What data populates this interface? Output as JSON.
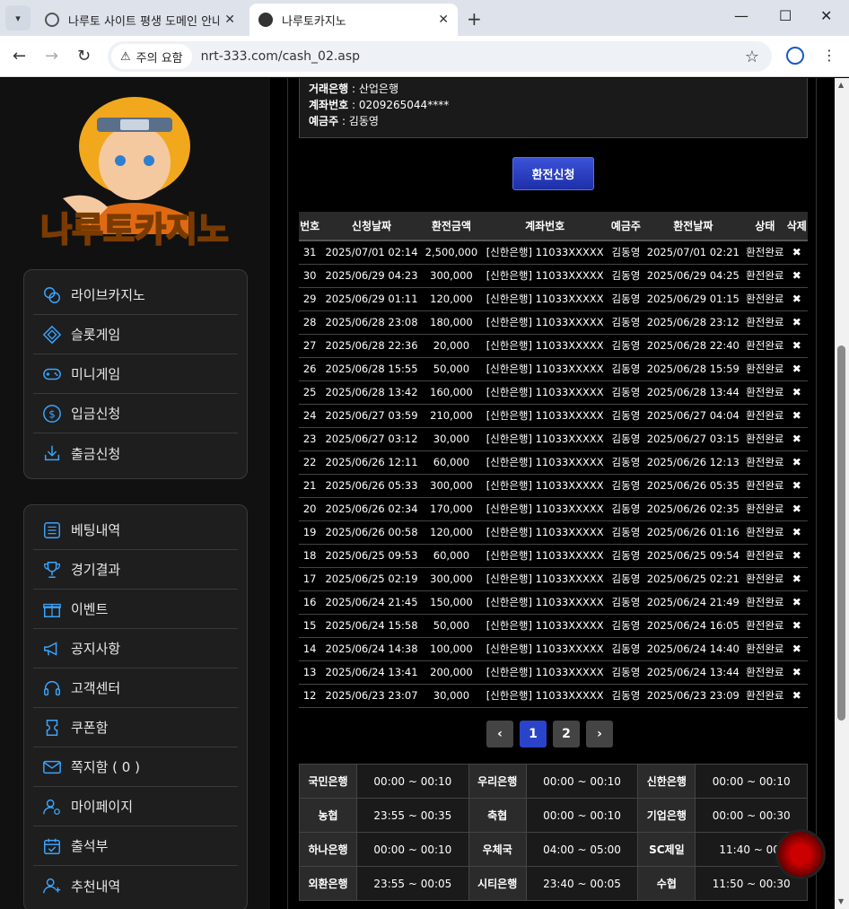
{
  "browser": {
    "tabs": [
      {
        "title": "나루토 사이트 평생 도메인 안내"
      },
      {
        "title": "나루토카지노"
      }
    ],
    "security_label": "주의 요함",
    "url": "nrt-333.com/cash_02.asp"
  },
  "sidebar": {
    "logo_text": "나루토카지노",
    "menu1": [
      {
        "label": "라이브카지노",
        "icon": "casino-chip-icon"
      },
      {
        "label": "슬롯게임",
        "icon": "diamond-icon"
      },
      {
        "label": "미니게임",
        "icon": "gamepad-icon"
      },
      {
        "label": "입금신청",
        "icon": "dollar-coin-icon"
      },
      {
        "label": "출금신청",
        "icon": "download-icon"
      }
    ],
    "menu2": [
      {
        "label": "베팅내역",
        "icon": "list-icon"
      },
      {
        "label": "경기결과",
        "icon": "trophy-icon"
      },
      {
        "label": "이벤트",
        "icon": "gift-icon"
      },
      {
        "label": "공지사항",
        "icon": "megaphone-icon"
      },
      {
        "label": "고객센터",
        "icon": "headset-icon"
      },
      {
        "label": "쿠폰함",
        "icon": "coupon-icon"
      },
      {
        "label": "쪽지함 ( 0 )",
        "icon": "envelope-icon"
      },
      {
        "label": "마이페이지",
        "icon": "user-gear-icon"
      },
      {
        "label": "출석부",
        "icon": "calendar-check-icon"
      },
      {
        "label": "추천내역",
        "icon": "user-plus-icon"
      }
    ]
  },
  "account": {
    "bank_label": "거래은행",
    "bank_value": "산업은행",
    "account_label": "계좌번호",
    "account_value": "0209265044****",
    "holder_label": "예금주",
    "holder_value": "김동영"
  },
  "withdraw_button": "환전신청",
  "table": {
    "headers": [
      "번호",
      "신청날짜",
      "환전금액",
      "계좌번호",
      "예금주",
      "환전날짜",
      "상태",
      "삭제"
    ],
    "rows": [
      [
        "31",
        "2025/07/01 02:14",
        "2,500,000",
        "[신한은행] 11033XXXXX",
        "김동영",
        "2025/07/01 02:21",
        "환전완료"
      ],
      [
        "30",
        "2025/06/29 04:23",
        "300,000",
        "[신한은행] 11033XXXXX",
        "김동영",
        "2025/06/29 04:25",
        "환전완료"
      ],
      [
        "29",
        "2025/06/29 01:11",
        "120,000",
        "[신한은행] 11033XXXXX",
        "김동영",
        "2025/06/29 01:15",
        "환전완료"
      ],
      [
        "28",
        "2025/06/28 23:08",
        "180,000",
        "[신한은행] 11033XXXXX",
        "김동영",
        "2025/06/28 23:12",
        "환전완료"
      ],
      [
        "27",
        "2025/06/28 22:36",
        "20,000",
        "[신한은행] 11033XXXXX",
        "김동영",
        "2025/06/28 22:40",
        "환전완료"
      ],
      [
        "26",
        "2025/06/28 15:55",
        "50,000",
        "[신한은행] 11033XXXXX",
        "김동영",
        "2025/06/28 15:59",
        "환전완료"
      ],
      [
        "25",
        "2025/06/28 13:42",
        "160,000",
        "[신한은행] 11033XXXXX",
        "김동영",
        "2025/06/28 13:44",
        "환전완료"
      ],
      [
        "24",
        "2025/06/27 03:59",
        "210,000",
        "[신한은행] 11033XXXXX",
        "김동영",
        "2025/06/27 04:04",
        "환전완료"
      ],
      [
        "23",
        "2025/06/27 03:12",
        "30,000",
        "[신한은행] 11033XXXXX",
        "김동영",
        "2025/06/27 03:15",
        "환전완료"
      ],
      [
        "22",
        "2025/06/26 12:11",
        "60,000",
        "[신한은행] 11033XXXXX",
        "김동영",
        "2025/06/26 12:13",
        "환전완료"
      ],
      [
        "21",
        "2025/06/26 05:33",
        "300,000",
        "[신한은행] 11033XXXXX",
        "김동영",
        "2025/06/26 05:35",
        "환전완료"
      ],
      [
        "20",
        "2025/06/26 02:34",
        "170,000",
        "[신한은행] 11033XXXXX",
        "김동영",
        "2025/06/26 02:35",
        "환전완료"
      ],
      [
        "19",
        "2025/06/26 00:58",
        "120,000",
        "[신한은행] 11033XXXXX",
        "김동영",
        "2025/06/26 01:16",
        "환전완료"
      ],
      [
        "18",
        "2025/06/25 09:53",
        "60,000",
        "[신한은행] 11033XXXXX",
        "김동영",
        "2025/06/25 09:54",
        "환전완료"
      ],
      [
        "17",
        "2025/06/25 02:19",
        "300,000",
        "[신한은행] 11033XXXXX",
        "김동영",
        "2025/06/25 02:21",
        "환전완료"
      ],
      [
        "16",
        "2025/06/24 21:45",
        "150,000",
        "[신한은행] 11033XXXXX",
        "김동영",
        "2025/06/24 21:49",
        "환전완료"
      ],
      [
        "15",
        "2025/06/24 15:58",
        "50,000",
        "[신한은행] 11033XXXXX",
        "김동영",
        "2025/06/24 16:05",
        "환전완료"
      ],
      [
        "14",
        "2025/06/24 14:38",
        "100,000",
        "[신한은행] 11033XXXXX",
        "김동영",
        "2025/06/24 14:40",
        "환전완료"
      ],
      [
        "13",
        "2025/06/24 13:41",
        "200,000",
        "[신한은행] 11033XXXXX",
        "김동영",
        "2025/06/24 13:44",
        "환전완료"
      ],
      [
        "12",
        "2025/06/23 23:07",
        "30,000",
        "[신한은행] 11033XXXXX",
        "김동영",
        "2025/06/23 23:09",
        "환전완료"
      ]
    ],
    "delete_glyph": "✖"
  },
  "pagination": {
    "prev": "‹",
    "pages": [
      "1",
      "2"
    ],
    "current": "1",
    "next": "›"
  },
  "bank_hours": [
    [
      "국민은행",
      "00:00 ~ 00:10",
      "우리은행",
      "00:00 ~ 00:10",
      "신한은행",
      "00:00 ~ 00:10"
    ],
    [
      "농협",
      "23:55 ~ 00:35",
      "축협",
      "00:00 ~ 00:10",
      "기업은행",
      "00:00 ~ 00:30"
    ],
    [
      "하나은행",
      "00:00 ~ 00:10",
      "우체국",
      "04:00 ~ 05:00",
      "SC제일",
      "11:40 ~ 00:"
    ],
    [
      "외환은행",
      "23:55 ~ 00:05",
      "시티은행",
      "23:40 ~ 00:05",
      "수협",
      "11:50 ~ 00:30"
    ]
  ]
}
